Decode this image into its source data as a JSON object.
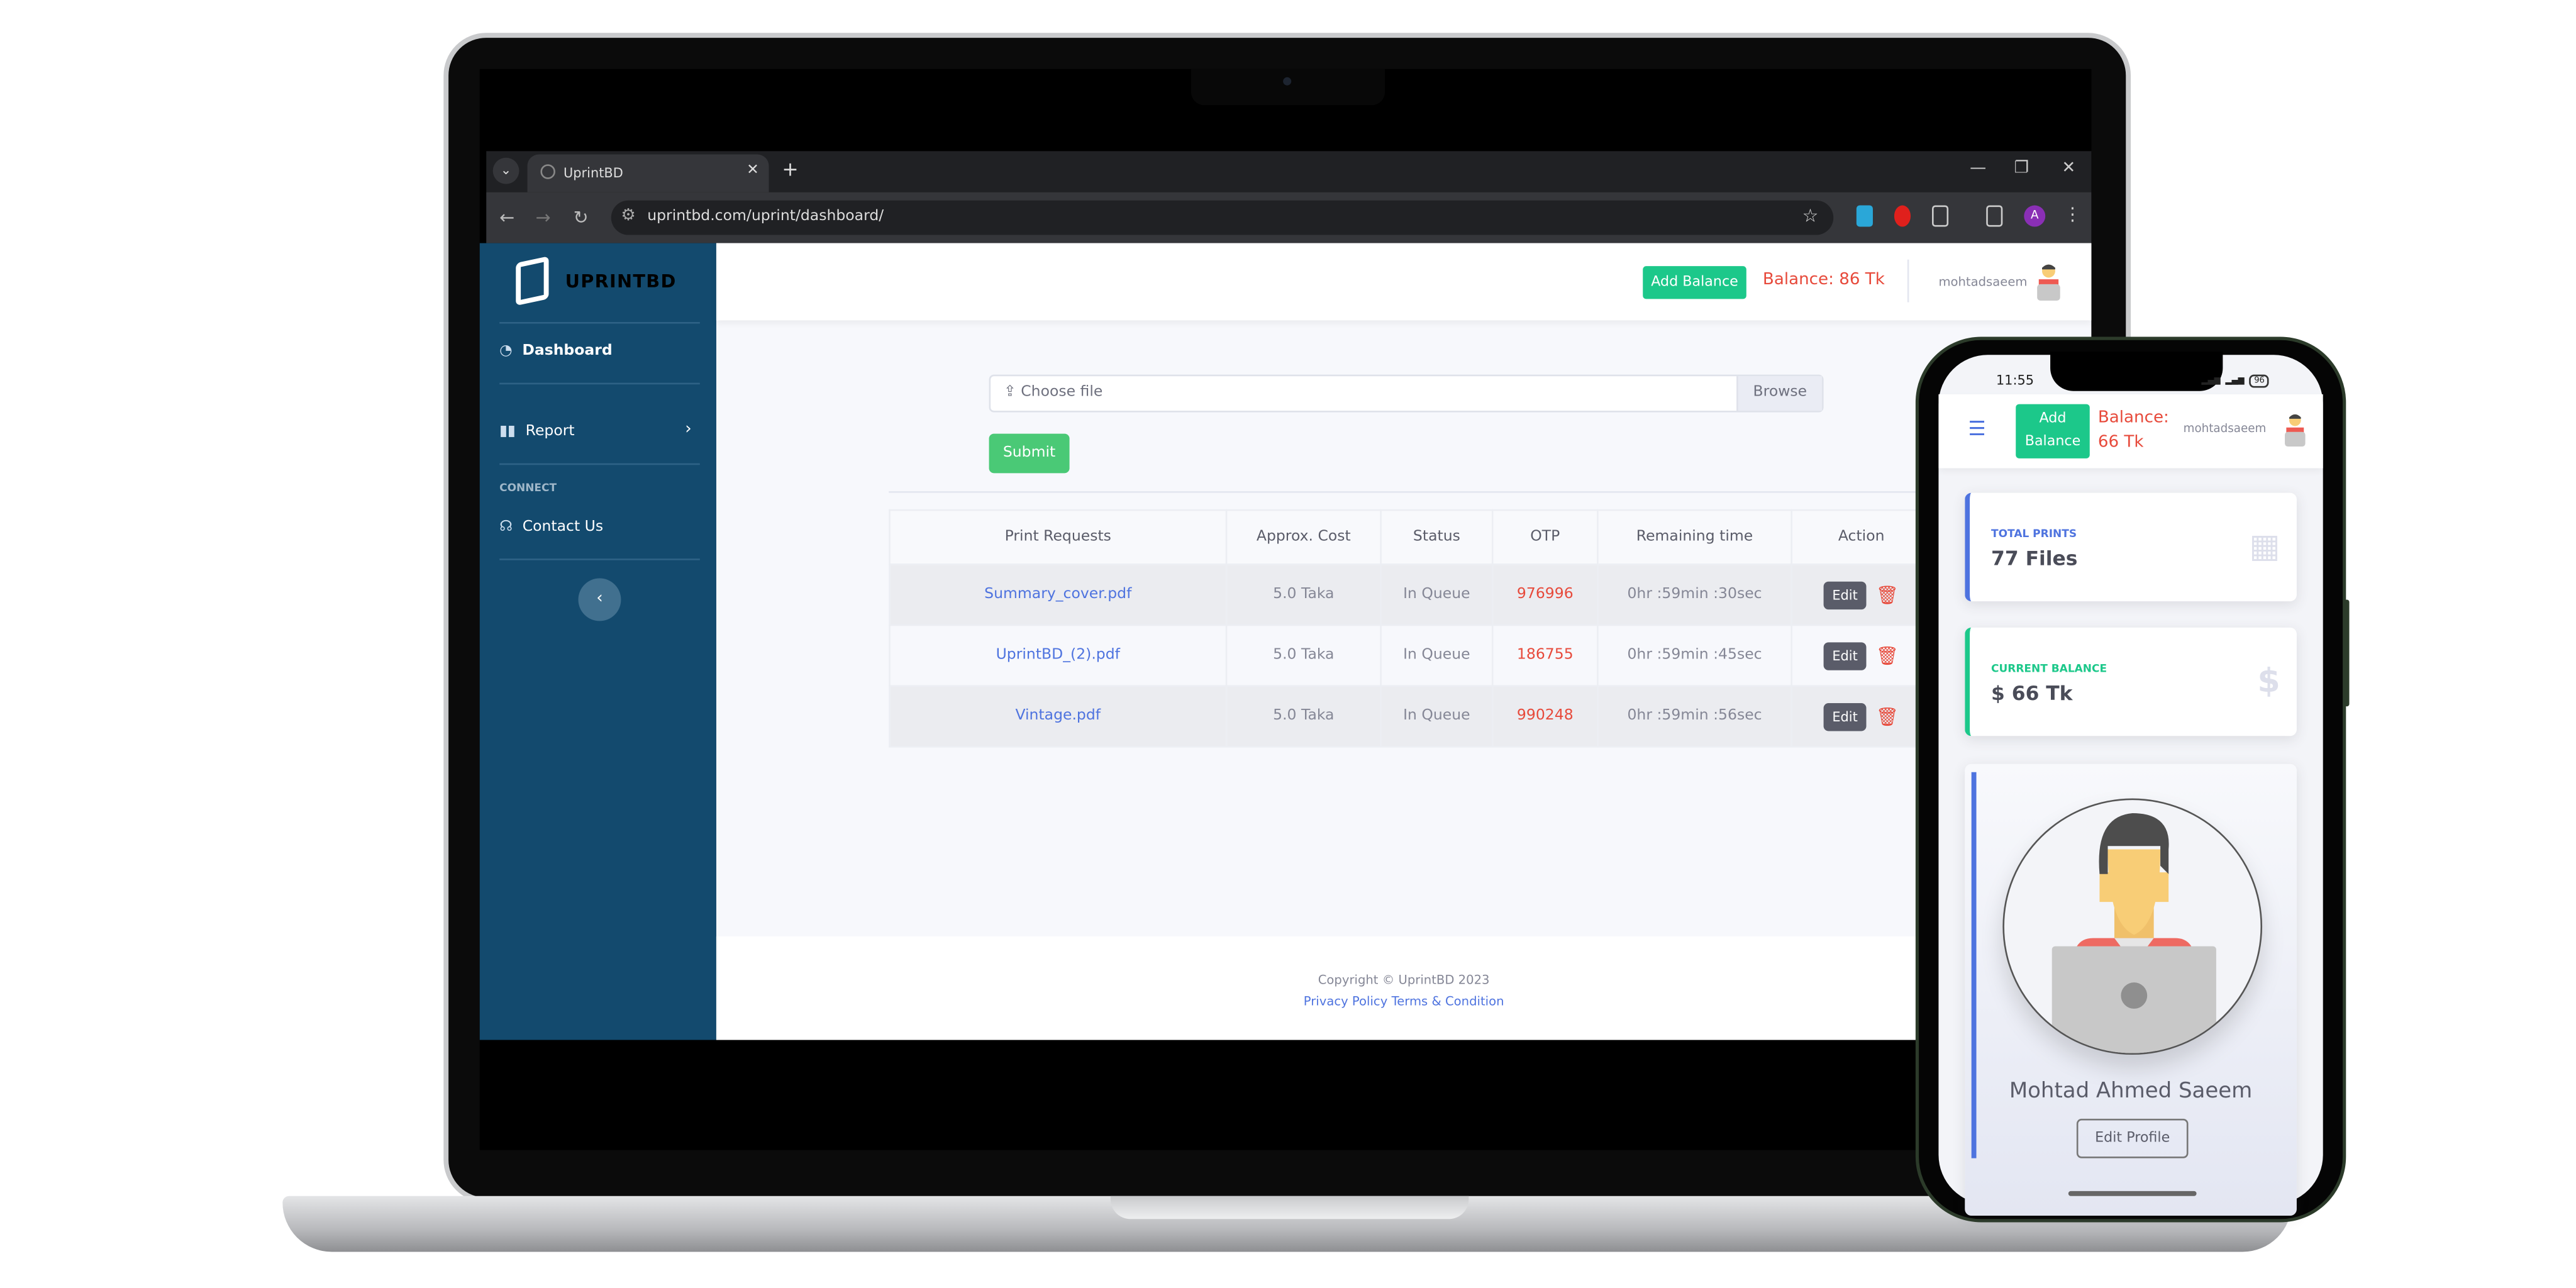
{
  "browser": {
    "tab_title": "UprintBD",
    "url": "uprintbd.com/uprint/dashboard/",
    "profile_initial": "A"
  },
  "sidebar": {
    "brand": "UPRINTBD",
    "items": [
      {
        "label": "Dashboard",
        "icon": "tachometer-icon"
      },
      {
        "label": "Report",
        "icon": "book-icon"
      },
      {
        "label": "Contact Us",
        "icon": "headset-icon"
      }
    ],
    "section_connect": "CONNECT"
  },
  "topbar": {
    "add_balance": "Add Balance",
    "balance": "Balance: 86 Tk",
    "username": "mohtadsaeem"
  },
  "upload": {
    "placeholder": "Choose file",
    "browse": "Browse",
    "submit": "Submit"
  },
  "table": {
    "headers": [
      "Print Requests",
      "Approx. Cost",
      "Status",
      "OTP",
      "Remaining time",
      "Action"
    ],
    "rows": [
      {
        "file": "Summary_cover.pdf",
        "cost": "5.0 Taka",
        "status": "In Queue",
        "otp": "976996",
        "remaining": "0hr :59min :30sec",
        "edit": "Edit"
      },
      {
        "file": "UprintBD_(2).pdf",
        "cost": "5.0 Taka",
        "status": "In Queue",
        "otp": "186755",
        "remaining": "0hr :59min :45sec",
        "edit": "Edit"
      },
      {
        "file": "Vintage.pdf",
        "cost": "5.0 Taka",
        "status": "In Queue",
        "otp": "990248",
        "remaining": "0hr :59min :56sec",
        "edit": "Edit"
      }
    ]
  },
  "footer": {
    "copyright": "Copyright © UprintBD 2023",
    "privacy": "Privacy Policy",
    "terms": "Terms & Condition"
  },
  "phone": {
    "time": "11:55",
    "battery": "96",
    "add_balance_line1": "Add",
    "add_balance_line2": "Balance",
    "balance_line1": "Balance:",
    "balance_line2": "66 Tk",
    "username": "mohtadsaeem",
    "cards": [
      {
        "title": "TOTAL PRINTS",
        "value": "77 Files",
        "color": "#4e73df",
        "icon": "calendar-icon"
      },
      {
        "title": "CURRENT BALANCE",
        "value": "$ 66 Tk",
        "color": "#1cc88a",
        "icon": "dollar-icon"
      }
    ],
    "profile_name": "Mohtad Ahmed Saeem",
    "edit_profile": "Edit Profile"
  },
  "colors": {
    "sidebar": "#134a6e",
    "success": "#1cc88a",
    "danger": "#e74a3b",
    "primary": "#4e73df"
  }
}
